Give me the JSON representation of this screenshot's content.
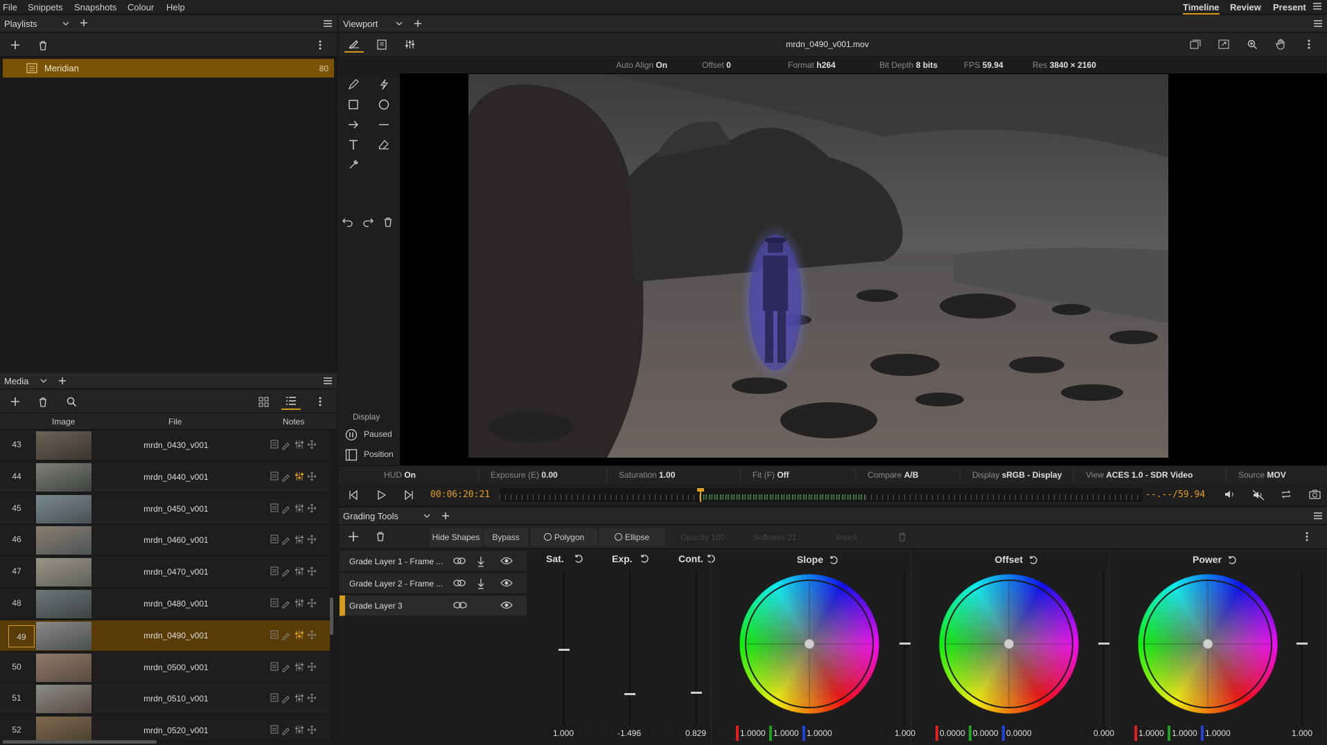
{
  "menu": [
    "File",
    "Snippets",
    "Snapshots",
    "Colour",
    "Help"
  ],
  "top_tabs": [
    "Timeline",
    "Review",
    "Present"
  ],
  "playlists": {
    "title": "Playlists",
    "items": [
      {
        "name": "Meridian",
        "count": "80"
      }
    ]
  },
  "media": {
    "title": "Media",
    "columns": [
      "Image",
      "File",
      "Notes"
    ],
    "rows": [
      {
        "num": "43",
        "file": "mrdn_0430_v001"
      },
      {
        "num": "44",
        "file": "mrdn_0440_v001"
      },
      {
        "num": "45",
        "file": "mrdn_0450_v001"
      },
      {
        "num": "46",
        "file": "mrdn_0460_v001"
      },
      {
        "num": "47",
        "file": "mrdn_0470_v001"
      },
      {
        "num": "48",
        "file": "mrdn_0480_v001"
      },
      {
        "num": "49",
        "file": "mrdn_0490_v001"
      },
      {
        "num": "50",
        "file": "mrdn_0500_v001"
      },
      {
        "num": "51",
        "file": "mrdn_0510_v001"
      },
      {
        "num": "52",
        "file": "mrdn_0520_v001"
      }
    ],
    "selected_num": "49"
  },
  "viewport": {
    "title": "Viewport",
    "filename": "mrdn_0490_v001.mov",
    "info": [
      {
        "label": "Auto Align",
        "value": "On"
      },
      {
        "label": "Offset",
        "value": "0"
      },
      {
        "label": "Format",
        "value": "h264"
      },
      {
        "label": "Bit Depth",
        "value": "8 bits"
      },
      {
        "label": "FPS",
        "value": "59.94"
      },
      {
        "label": "Res",
        "value": "3840 × 2160"
      }
    ],
    "display_label": "Display",
    "paused_label": "Paused",
    "position_label": "Position",
    "hud": [
      {
        "label": "HUD",
        "value": "On"
      },
      {
        "label": "Exposure (E)",
        "value": "0.00"
      },
      {
        "label": "Saturation",
        "value": "1.00"
      },
      {
        "label": "Fit (F)",
        "value": "Off"
      },
      {
        "label": "Compare",
        "value": "A/B"
      },
      {
        "label": "Display",
        "value": "sRGB - Display"
      },
      {
        "label": "View",
        "value": "ACES 1.0 - SDR Video"
      },
      {
        "label": "Source",
        "value": "MOV"
      }
    ],
    "timecode": "00:06:20:21",
    "fps_readout": "--.--/59.94"
  },
  "grading": {
    "title": "Grading Tools",
    "buttons": {
      "hide_shapes": "Hide Shapes",
      "bypass": "Bypass",
      "polygon": "Polygon",
      "ellipse": "Ellipse",
      "opacity": "Opacity 100",
      "softness": "Softness 21",
      "invert": "Invert"
    },
    "layers": [
      {
        "name": "Grade Layer 1 - Frame ..."
      },
      {
        "name": "Grade Layer 2 - Frame ..."
      },
      {
        "name": "Grade Layer 3"
      }
    ],
    "sliders": [
      {
        "name": "Sat.",
        "value": "1.000",
        "level": 0.5
      },
      {
        "name": "Exp.",
        "value": "-1.496",
        "level": 0.22
      },
      {
        "name": "Cont.",
        "value": "0.829",
        "level": 0.23
      }
    ],
    "wheels": [
      {
        "name": "Slope",
        "r": "1.0000",
        "g": "1.0000",
        "b": "1.0000",
        "master": "1.000"
      },
      {
        "name": "Offset",
        "r": "0.0000",
        "g": "0.0000",
        "b": "0.0000",
        "master": "0.000"
      },
      {
        "name": "Power",
        "r": "1.0000",
        "g": "1.0000",
        "b": "1.0000",
        "master": "1.000"
      }
    ]
  },
  "colors": {
    "accent": "#d49a1a",
    "selected_row": "#5a3d06",
    "timecode": "#e0a020"
  }
}
